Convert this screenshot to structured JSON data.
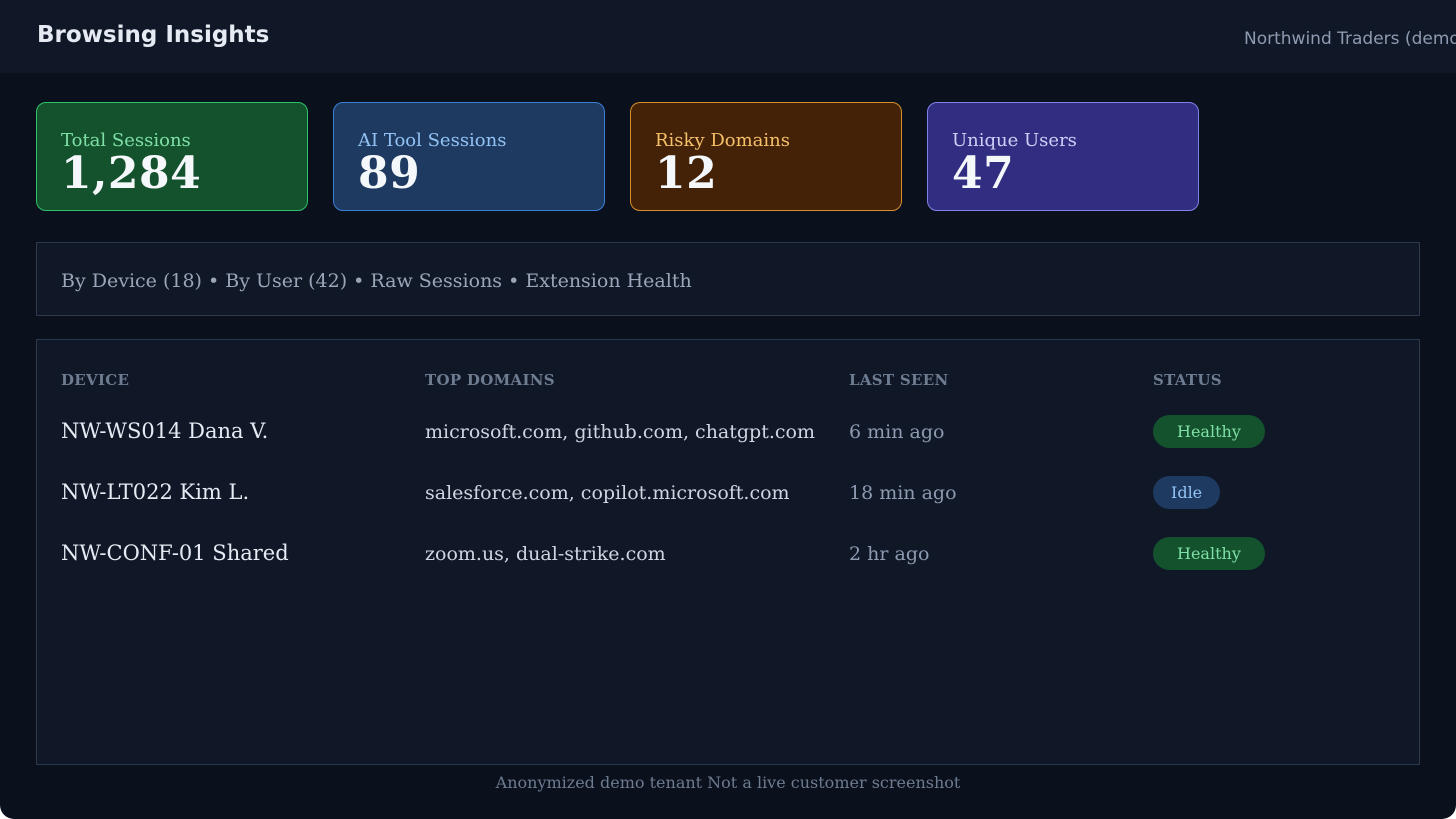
{
  "header": {
    "title": "Browsing Insights",
    "tenant": "Northwind Traders (demo)"
  },
  "stats": [
    {
      "label": "Total Sessions",
      "value": "1,284"
    },
    {
      "label": "AI Tool Sessions",
      "value": "89"
    },
    {
      "label": "Risky Domains",
      "value": "12"
    },
    {
      "label": "Unique Users",
      "value": "47"
    }
  ],
  "tabs": [
    {
      "label": "By Device (18)"
    },
    {
      "label": "By User (42)"
    },
    {
      "label": "Raw Sessions"
    },
    {
      "label": "Extension Health"
    }
  ],
  "tab_separator": " • ",
  "table": {
    "columns": [
      "DEVICE",
      "TOP DOMAINS",
      "LAST SEEN",
      "STATUS"
    ],
    "rows": [
      {
        "device": "NW-WS014 Dana V.",
        "domains": "microsoft.com, github.com, chatgpt.com",
        "last_seen": "6 min ago",
        "status": "Healthy"
      },
      {
        "device": "NW-LT022 Kim L.",
        "domains": "salesforce.com, copilot.microsoft.com",
        "last_seen": "18 min ago",
        "status": "Idle"
      },
      {
        "device": "NW-CONF-01 Shared",
        "domains": "zoom.us, dual-strike.com",
        "last_seen": "2 hr ago",
        "status": "Healthy"
      }
    ]
  },
  "footer": {
    "note": "Anonymized demo tenant Not a live customer screenshot"
  },
  "colors": {
    "background": "#0a101c",
    "panel": "#101828",
    "healthy": "#7fe0a6",
    "idle": "#93c3f5",
    "sessions_accent": "#2fc168",
    "ai_accent": "#3b7fd6",
    "risky_accent": "#d9902c",
    "users_accent": "#7f83e8"
  }
}
